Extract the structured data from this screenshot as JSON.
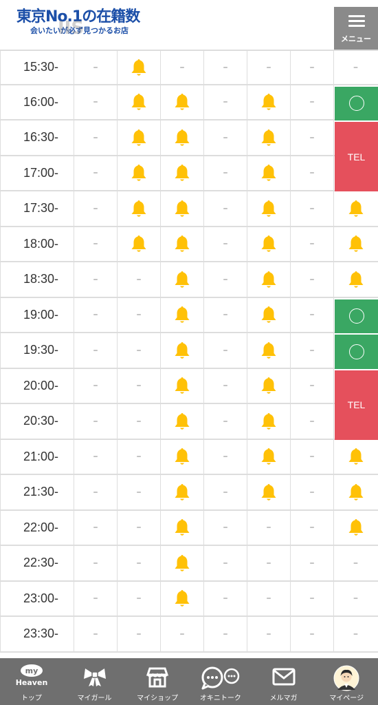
{
  "header": {
    "logo_title": "東京No.1の在籍数",
    "logo_subtitle": "会いたいが必ず見つかるお店",
    "menu_label": "メニュー"
  },
  "schedule": {
    "rows": [
      {
        "time": "15:30-",
        "cells": [
          "–",
          "bell",
          "–",
          "–",
          "–",
          "–",
          "–"
        ]
      },
      {
        "time": "16:00-",
        "cells": [
          "–",
          "bell",
          "bell",
          "–",
          "bell",
          "–",
          "ok"
        ]
      },
      {
        "time": "16:30-",
        "cells": [
          "–",
          "bell",
          "bell",
          "–",
          "bell",
          "–",
          "tel"
        ]
      },
      {
        "time": "17:00-",
        "cells": [
          "–",
          "bell",
          "bell",
          "–",
          "bell",
          "–",
          "tel"
        ]
      },
      {
        "time": "17:30-",
        "cells": [
          "–",
          "bell",
          "bell",
          "–",
          "bell",
          "–",
          "bell"
        ]
      },
      {
        "time": "18:00-",
        "cells": [
          "–",
          "bell",
          "bell",
          "–",
          "bell",
          "–",
          "bell"
        ]
      },
      {
        "time": "18:30-",
        "cells": [
          "–",
          "–",
          "bell",
          "–",
          "bell",
          "–",
          "bell"
        ]
      },
      {
        "time": "19:00-",
        "cells": [
          "–",
          "–",
          "bell",
          "–",
          "bell",
          "–",
          "ok"
        ]
      },
      {
        "time": "19:30-",
        "cells": [
          "–",
          "–",
          "bell",
          "–",
          "bell",
          "–",
          "ok"
        ]
      },
      {
        "time": "20:00-",
        "cells": [
          "–",
          "–",
          "bell",
          "–",
          "bell",
          "–",
          "tel"
        ]
      },
      {
        "time": "20:30-",
        "cells": [
          "–",
          "–",
          "bell",
          "–",
          "bell",
          "–",
          "tel"
        ]
      },
      {
        "time": "21:00-",
        "cells": [
          "–",
          "–",
          "bell",
          "–",
          "bell",
          "–",
          "bell"
        ]
      },
      {
        "time": "21:30-",
        "cells": [
          "–",
          "–",
          "bell",
          "–",
          "bell",
          "–",
          "bell"
        ]
      },
      {
        "time": "22:00-",
        "cells": [
          "–",
          "–",
          "bell",
          "–",
          "–",
          "–",
          "bell"
        ]
      },
      {
        "time": "22:30-",
        "cells": [
          "–",
          "–",
          "bell",
          "–",
          "–",
          "–",
          "–"
        ]
      },
      {
        "time": "23:00-",
        "cells": [
          "–",
          "–",
          "bell",
          "–",
          "–",
          "–",
          "–"
        ]
      },
      {
        "time": "23:30-",
        "cells": [
          "–",
          "–",
          "–",
          "–",
          "–",
          "–",
          "–"
        ]
      }
    ],
    "tel_label": "TEL",
    "colors": {
      "bell": "#ffc107",
      "ok": "#3aa763",
      "tel": "#e5505c"
    }
  },
  "bottom_nav": {
    "items": [
      {
        "label": "トップ",
        "icon": "my-heaven-icon",
        "badge_top": "my",
        "badge_bottom": "Heaven"
      },
      {
        "label": "マイガール",
        "icon": "ribbon-icon"
      },
      {
        "label": "マイショップ",
        "icon": "shop-icon"
      },
      {
        "label": "オキニトーク",
        "icon": "chat-icon"
      },
      {
        "label": "メルマガ",
        "icon": "mail-icon"
      },
      {
        "label": "マイページ",
        "icon": "avatar-icon"
      }
    ]
  }
}
